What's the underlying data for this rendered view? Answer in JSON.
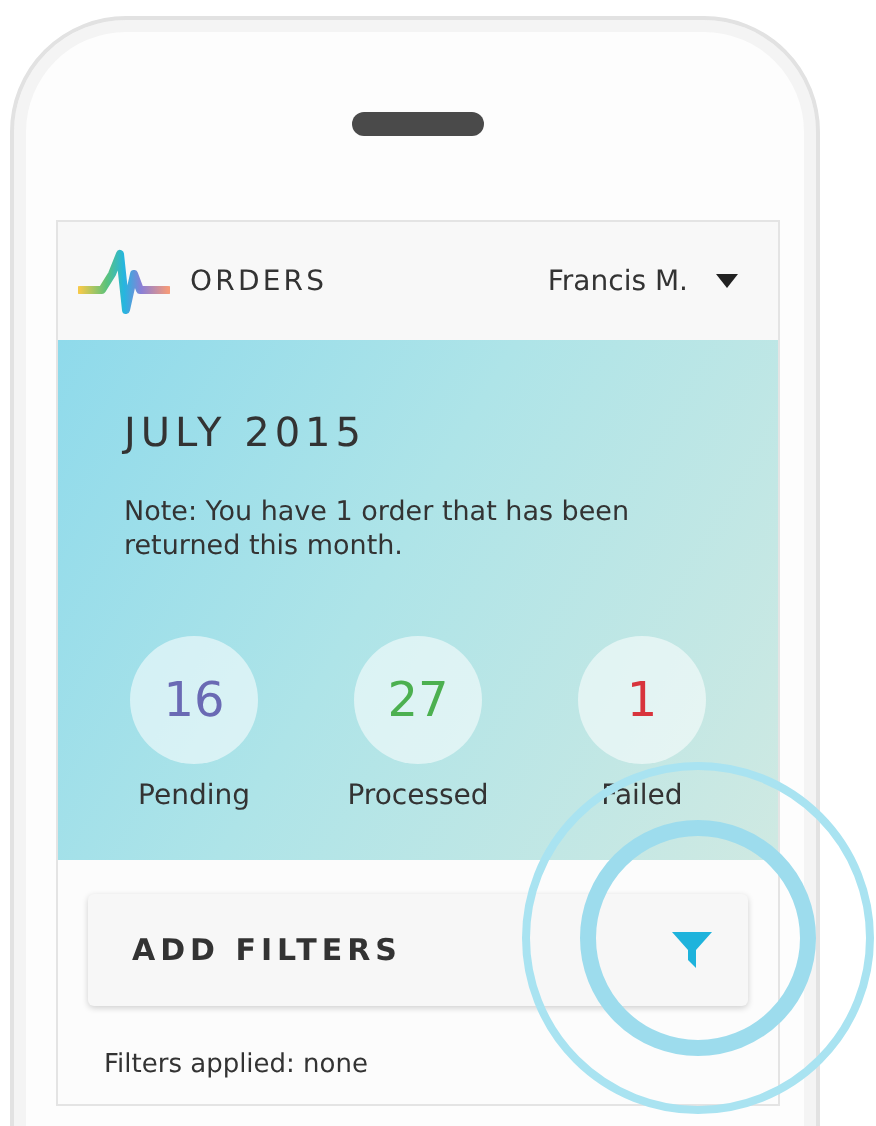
{
  "header": {
    "title": "ORDERS",
    "user": "Francis M."
  },
  "banner": {
    "month": "JULY 2015",
    "note": "Note: You have 1 order that has been returned this month."
  },
  "stats": [
    {
      "value": "16",
      "label": "Pending",
      "color": "#6a6ab4"
    },
    {
      "value": "27",
      "label": "Processed",
      "color": "#4cb050"
    },
    {
      "value": "1",
      "label": "Failed",
      "color": "#d8343c"
    }
  ],
  "filter_button": {
    "label": "ADD FILTERS"
  },
  "filters_applied": "Filters applied: none"
}
